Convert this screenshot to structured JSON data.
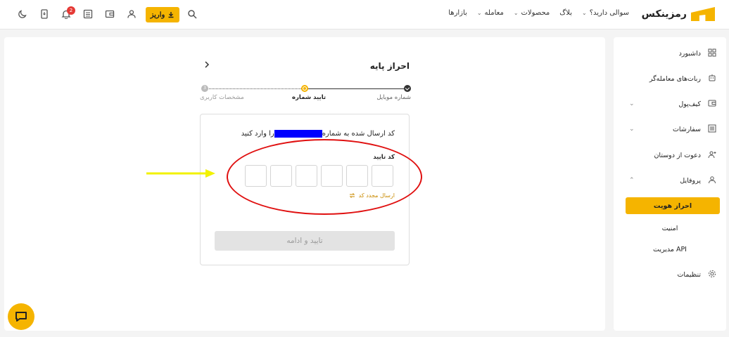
{
  "header": {
    "brand": "رمزینکس",
    "nav": [
      {
        "label": "بازارها",
        "has_dropdown": false
      },
      {
        "label": "معامله",
        "has_dropdown": true
      },
      {
        "label": "محصولات",
        "has_dropdown": true
      },
      {
        "label": "بلاگ",
        "has_dropdown": false
      },
      {
        "label": "سوالی دارید؟",
        "has_dropdown": true
      }
    ],
    "deposit_label": "واریز",
    "notification_count": "2",
    "icons": [
      "search-icon",
      "user-icon",
      "wallet-icon",
      "orders-icon",
      "bell-icon",
      "phone-download-icon",
      "moon-icon"
    ],
    "accent": "#f5b400"
  },
  "sidebar": {
    "items": [
      {
        "label": "داشبورد",
        "icon": "grid-icon"
      },
      {
        "label": "ربات‌های معامله‌گر",
        "icon": "robot-icon"
      },
      {
        "label": "کیف‌پول",
        "icon": "wallet-icon",
        "chevron": "down"
      },
      {
        "label": "سفارشات",
        "icon": "list-icon",
        "chevron": "down"
      },
      {
        "label": "دعوت از دوستان",
        "icon": "user-plus-icon"
      },
      {
        "label": "پروفایل",
        "icon": "user-icon",
        "chevron": "up"
      }
    ],
    "profile_sub": [
      {
        "label": "احراز هویت",
        "active": true
      },
      {
        "label": "امنیت",
        "active": false
      },
      {
        "label": "مدیریت API",
        "active": false
      }
    ],
    "settings": {
      "label": "تنظیمات",
      "icon": "gear-icon"
    }
  },
  "main": {
    "title": "احراز پایه",
    "steps": [
      {
        "label": "شماره موبایل",
        "state": "done"
      },
      {
        "label": "تایید شماره",
        "state": "current"
      },
      {
        "label": "مشخصات کاربری",
        "state": "todo",
        "number": "3"
      }
    ],
    "instruction_before": "کد ارسال شده به شماره",
    "instruction_after": "را وارد کنید",
    "code_label": "کد تایید",
    "otp_length": 6,
    "resend_label": "ارسال مجدد کد",
    "submit_label": "تایید و ادامه"
  }
}
